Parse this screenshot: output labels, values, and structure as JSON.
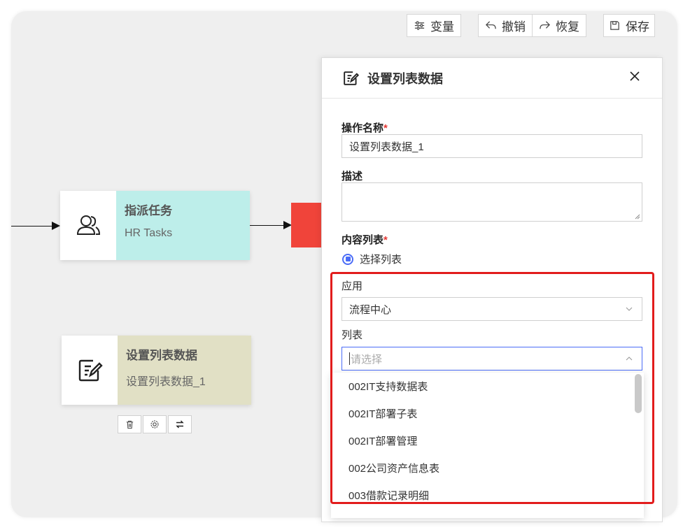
{
  "toolbar": {
    "variables_label": "变量",
    "undo_label": "撤销",
    "redo_label": "恢复",
    "save_label": "保存"
  },
  "nodes": {
    "assign": {
      "title": "指派任务",
      "subtitle": "HR Tasks",
      "icon": "users-icon",
      "color": "#bdeeea"
    },
    "set_list": {
      "title": "设置列表数据",
      "subtitle": "设置列表数据_1",
      "icon": "edit-icon",
      "color": "#e1e0c5"
    }
  },
  "panel": {
    "title": "设置列表数据",
    "name_label": "操作名称",
    "name_value": "设置列表数据_1",
    "desc_label": "描述",
    "desc_value": "",
    "content_label": "内容列表",
    "radio_label": "选择列表",
    "app_label": "应用",
    "app_value": "流程中心",
    "list_label": "列表",
    "list_placeholder": "请选择",
    "required_mark": "*"
  },
  "dropdown": {
    "options": [
      "002IT支持数据表",
      "002IT部署子表",
      "002IT部署管理",
      "002公司资产信息表",
      "003借款记录明细"
    ]
  },
  "colors": {
    "accent": "#4a6cf7",
    "highlight": "#e21c1c",
    "red_block": "#f0443a"
  }
}
